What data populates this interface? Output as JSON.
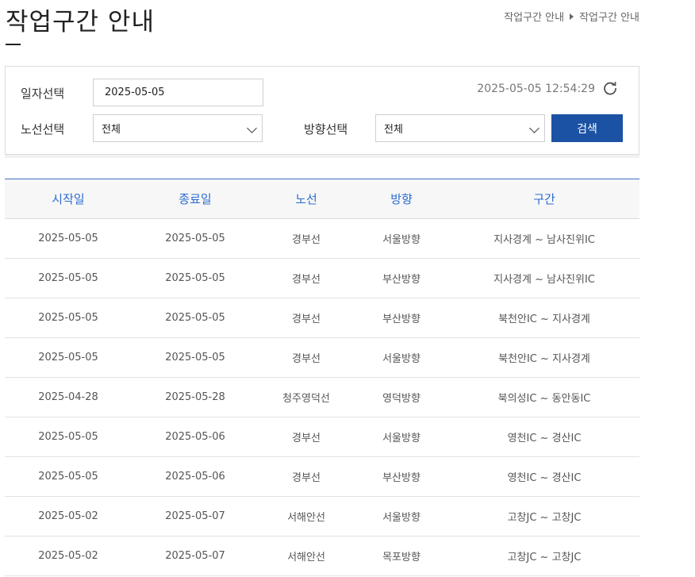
{
  "header": {
    "title": "작업구간 안내",
    "breadcrumb": [
      "작업구간 안내",
      "작업구간 안내"
    ]
  },
  "search": {
    "date_label": "일자선택",
    "date_value": "2025-05-05",
    "route_label": "노선선택",
    "route_value": "전체",
    "direction_label": "방향선택",
    "direction_value": "전체",
    "datetime": "2025-05-05 12:54:29",
    "search_button": "검색"
  },
  "table": {
    "headers": [
      "시작일",
      "종료일",
      "노선",
      "방향",
      "구간"
    ],
    "rows": [
      [
        "2025-05-05",
        "2025-05-05",
        "경부선",
        "서울방향",
        "지사경계 ~ 남사진위IC"
      ],
      [
        "2025-05-05",
        "2025-05-05",
        "경부선",
        "부산방향",
        "지사경계 ~ 남사진위IC"
      ],
      [
        "2025-05-05",
        "2025-05-05",
        "경부선",
        "부산방향",
        "북천안IC ~ 지사경계"
      ],
      [
        "2025-05-05",
        "2025-05-05",
        "경부선",
        "서울방향",
        "북천안IC ~ 지사경계"
      ],
      [
        "2025-04-28",
        "2025-05-28",
        "청주영덕선",
        "영덕방향",
        "북의성IC ~ 동안동IC"
      ],
      [
        "2025-05-05",
        "2025-05-06",
        "경부선",
        "서울방향",
        "영천IC ~ 경산IC"
      ],
      [
        "2025-05-05",
        "2025-05-06",
        "경부선",
        "부산방향",
        "영천IC ~ 경산IC"
      ],
      [
        "2025-05-02",
        "2025-05-07",
        "서해안선",
        "서울방향",
        "고창JC ~ 고창JC"
      ],
      [
        "2025-05-02",
        "2025-05-07",
        "서해안선",
        "목포방향",
        "고창JC ~ 고창JC"
      ]
    ]
  },
  "colors": {
    "accent": "#1b52a4",
    "header_text": "#2d6cd0"
  }
}
